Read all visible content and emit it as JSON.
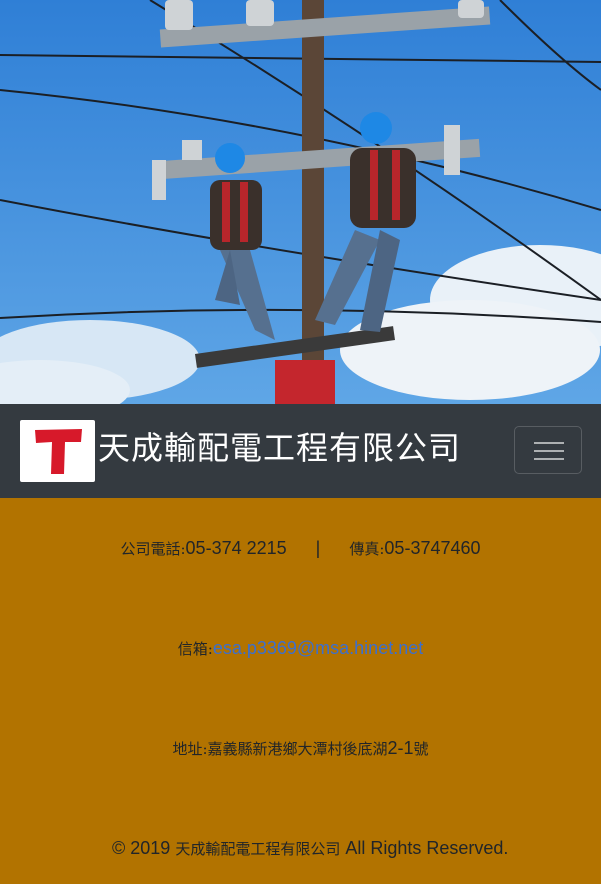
{
  "navbar": {
    "logo_letter": "T",
    "brand": "天成輸配電工程有限公司",
    "menu_icon": "hamburger-icon"
  },
  "contact": {
    "phone_label": "公司電話:",
    "phone": "05-374 2215",
    "separator": "|",
    "fax_label": "傳真:",
    "fax": "05-3747460",
    "email_label": "信箱:",
    "email": "esa.p3369@msa.hinet.net",
    "address_label": "地址:",
    "address": "嘉義縣新港鄉大潭村後底湖",
    "address_no": "2-1",
    "address_suffix": "號"
  },
  "footer": {
    "copyright": "© 2019",
    "company": "天成輸配電工程有限公司",
    "rights": "All Rights Reserved."
  },
  "colors": {
    "navbar_bg": "#343A40",
    "section_bg": "#B27300",
    "logo_red": "#D7192A",
    "link": "#3B6FCF"
  }
}
